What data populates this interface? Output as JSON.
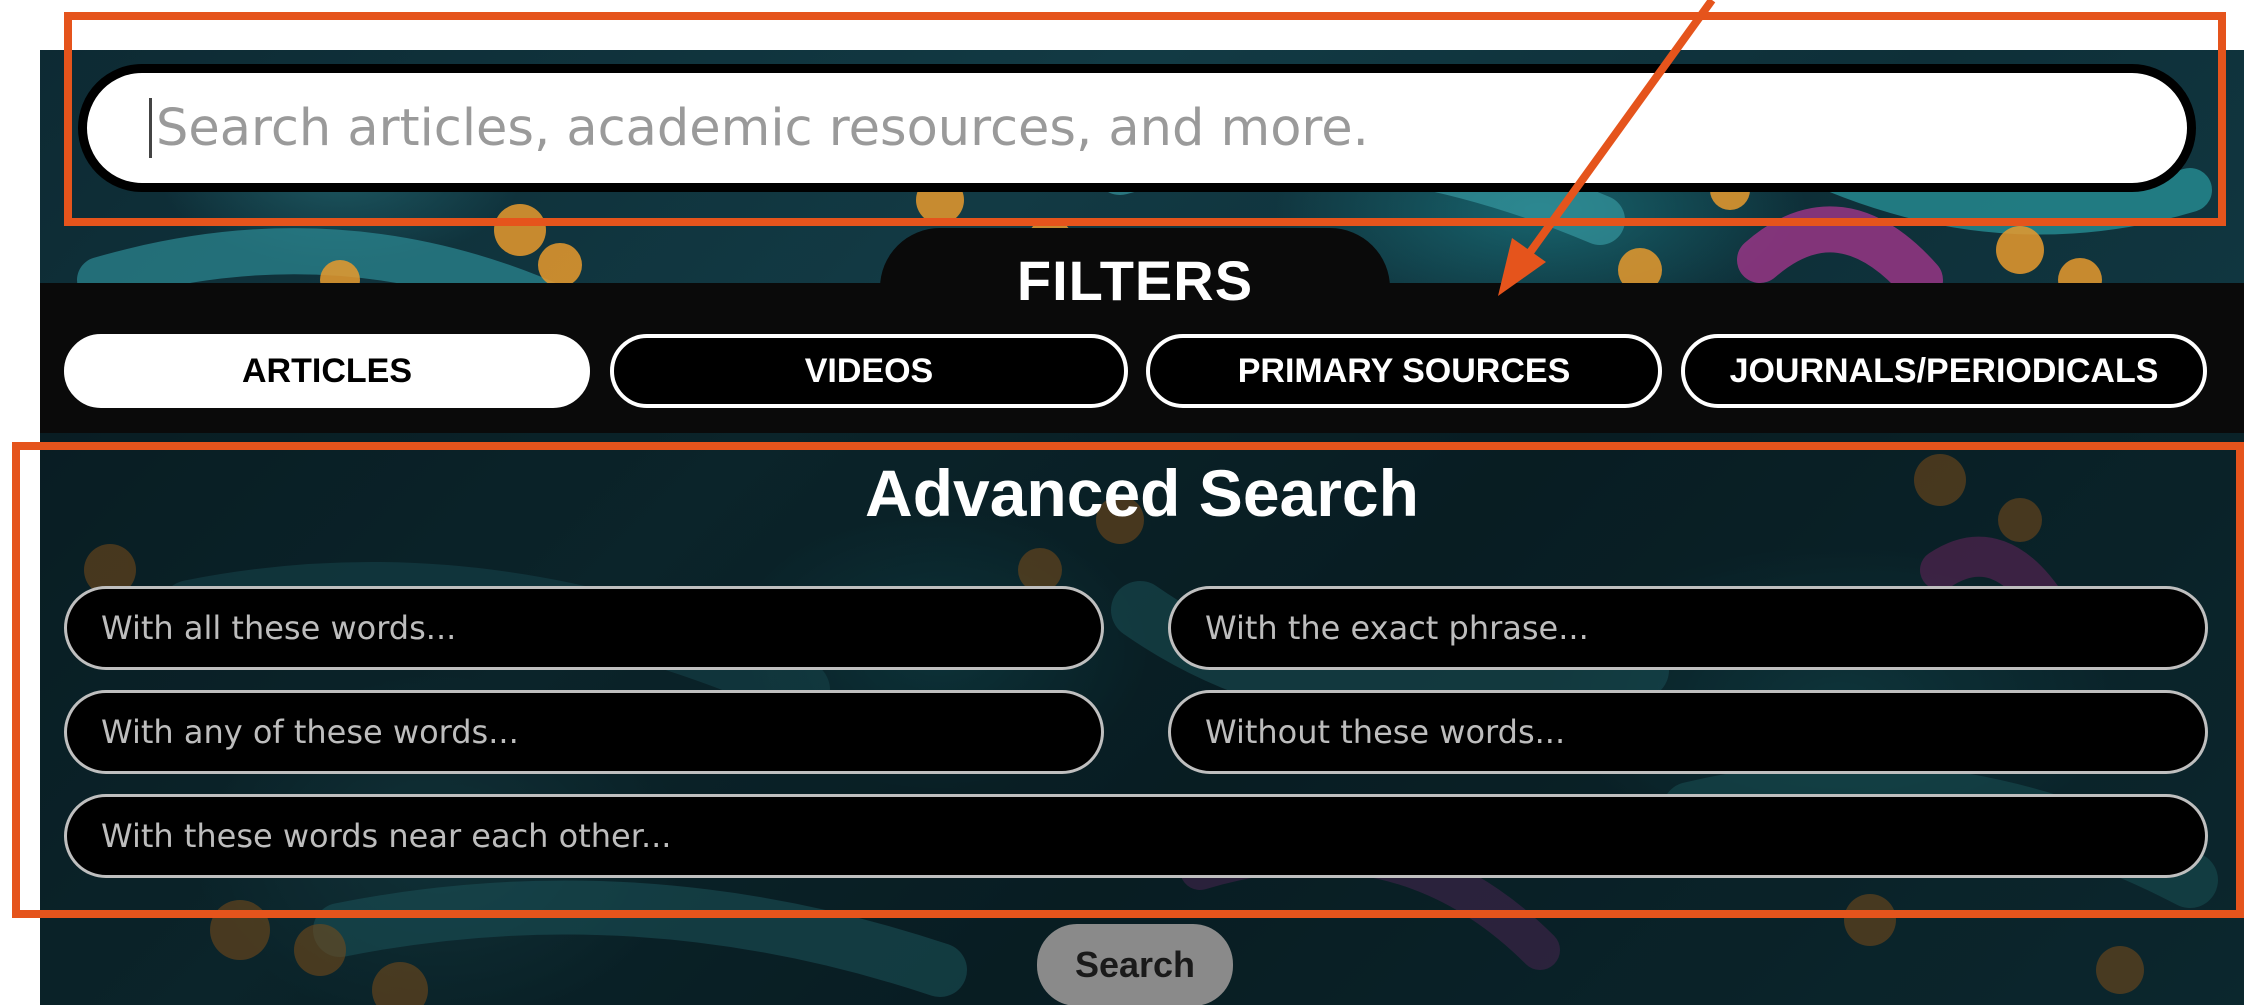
{
  "main_search": {
    "placeholder": "Search articles, academic resources, and more."
  },
  "filters": {
    "title": "FILTERS",
    "items": [
      {
        "label": "ARTICLES",
        "active": true
      },
      {
        "label": "VIDEOS",
        "active": false
      },
      {
        "label": "PRIMARY SOURCES",
        "active": false
      },
      {
        "label": "JOURNALS/PERIODICALS",
        "active": false
      }
    ]
  },
  "advanced": {
    "title": "Advanced Search",
    "fields": [
      {
        "placeholder": "With all these words..."
      },
      {
        "placeholder": "With the exact phrase..."
      },
      {
        "placeholder": "With any of these words..."
      },
      {
        "placeholder": "Without these words..."
      },
      {
        "placeholder": "With these words near each other..."
      }
    ],
    "search_label": "Search"
  },
  "colors": {
    "annotation": "#e5541c",
    "filter_active_bg": "#ffffff",
    "filter_bg": "#000000",
    "search_button_bg": "#8a8a8a"
  },
  "icons": {
    "annotation_arrow": "arrow-icon"
  }
}
